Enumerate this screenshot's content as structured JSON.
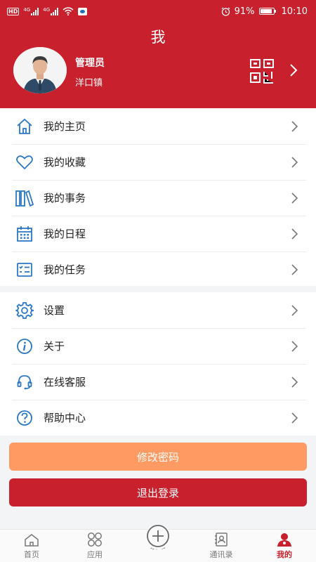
{
  "status_bar": {
    "hd_badge": "HD",
    "network_1": "4G",
    "network_2": "4G",
    "battery_percent": "91%",
    "battery_level": 0.91,
    "time": "10:10"
  },
  "header": {
    "title": "我",
    "user_name": "管理员",
    "user_org": "洋口镇",
    "qr_icon": "qr-code-icon",
    "background_color": "#c8202c"
  },
  "menu_group_1": [
    {
      "label": "我的主页",
      "icon": "home-icon"
    },
    {
      "label": "我的收藏",
      "icon": "heart-icon"
    },
    {
      "label": "我的事务",
      "icon": "books-icon"
    },
    {
      "label": "我的日程",
      "icon": "calendar-icon"
    },
    {
      "label": "我的任务",
      "icon": "task-list-icon"
    }
  ],
  "menu_group_2": [
    {
      "label": "设置",
      "icon": "gear-icon"
    },
    {
      "label": "关于",
      "icon": "info-icon"
    },
    {
      "label": "在线客服",
      "icon": "headset-icon"
    },
    {
      "label": "帮助中心",
      "icon": "help-icon"
    }
  ],
  "buttons": {
    "change_password": "修改密码",
    "logout": "退出登录",
    "orange_color": "#ff9a62",
    "red_color": "#c8202c"
  },
  "tabbar": [
    {
      "label": "首页",
      "icon": "home-icon",
      "active": false
    },
    {
      "label": "应用",
      "icon": "apps-icon",
      "active": false
    },
    {
      "label": "发布",
      "icon": "plus-circle-icon",
      "active": false
    },
    {
      "label": "通讯录",
      "icon": "contacts-icon",
      "active": false
    },
    {
      "label": "我的",
      "icon": "user-icon",
      "active": true
    }
  ]
}
